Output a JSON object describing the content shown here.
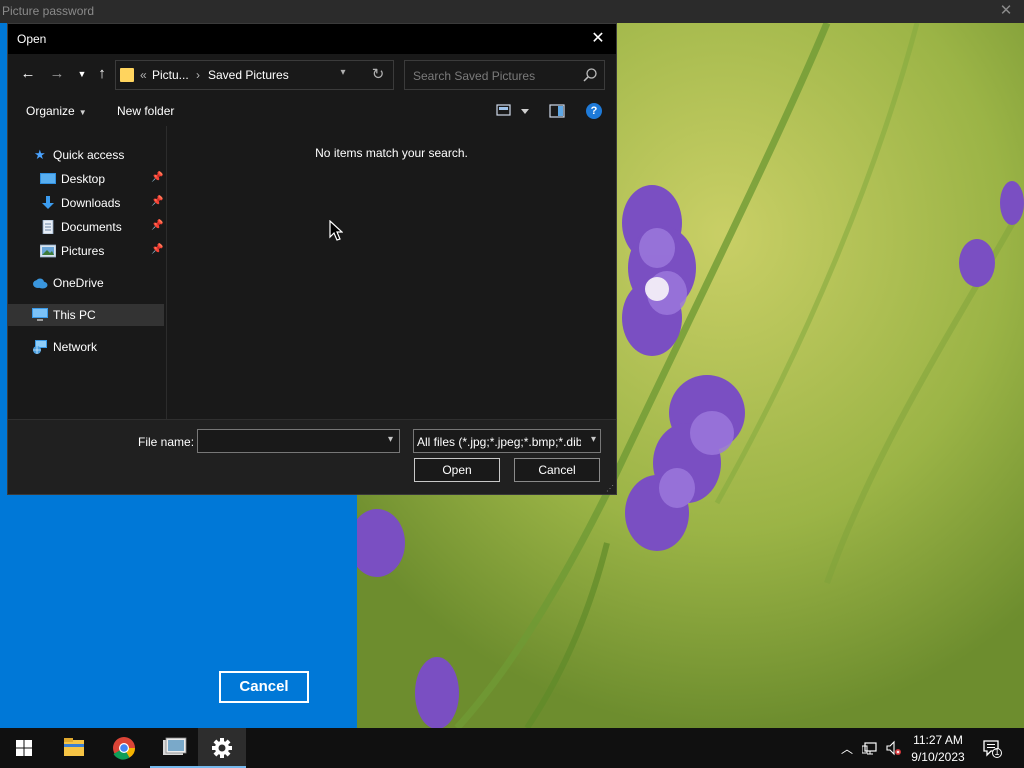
{
  "host_window": {
    "title": "Picture password",
    "cancel_label": "Cancel"
  },
  "dialog": {
    "title": "Open",
    "breadcrumb": {
      "overflow": "«",
      "parent": "Pictu...",
      "separator": "›",
      "current": "Saved Pictures"
    },
    "search_placeholder": "Search Saved Pictures",
    "toolbar": {
      "organize_label": "Organize",
      "new_folder_label": "New folder",
      "help_label": "?"
    },
    "sidebar": {
      "quick_access": "Quick access",
      "desktop": "Desktop",
      "downloads": "Downloads",
      "documents": "Documents",
      "pictures": "Pictures",
      "onedrive": "OneDrive",
      "this_pc": "This PC",
      "network": "Network"
    },
    "empty_message": "No items match your search.",
    "file_name_label": "File name:",
    "file_name_value": "",
    "file_type_selected": "All files (*.jpg;*.jpeg;*.bmp;*.dib;*.png;*.gif)",
    "open_label": "Open",
    "cancel_label": "Cancel"
  },
  "taskbar": {
    "time": "11:27 AM",
    "date": "9/10/2023",
    "notification_count": "1"
  },
  "colors": {
    "accent_blue": "#0078d7",
    "folder_yellow": "#ffd45e",
    "taskbar_indicator": "#76b9ed"
  }
}
